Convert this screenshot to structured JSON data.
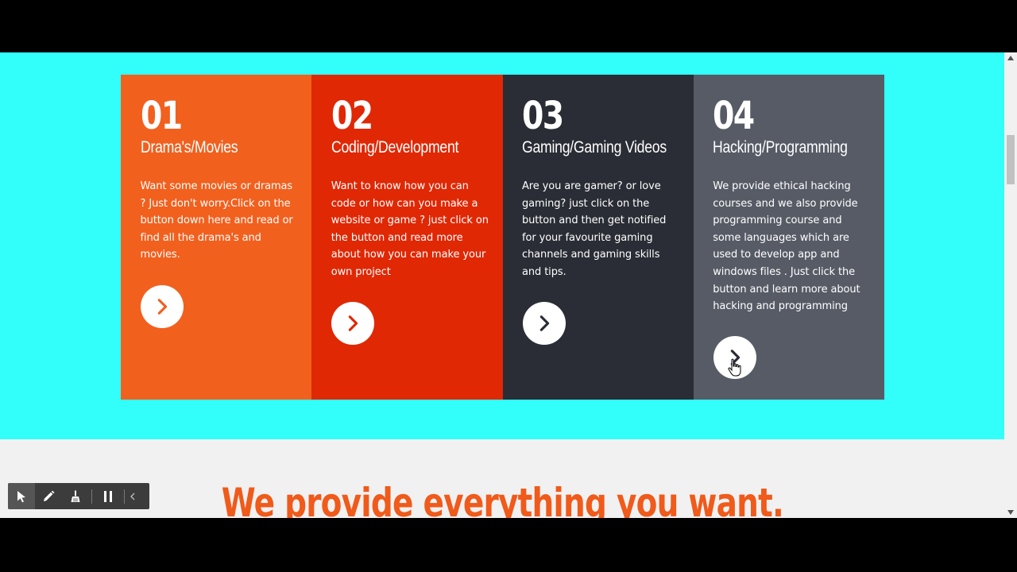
{
  "colors": {
    "cyan_band": "#32fff9",
    "card1": "#f2601e",
    "card2": "#e02805",
    "card3": "#2a2d35",
    "card4": "#575b66",
    "headline": "#f05a1a"
  },
  "cards": [
    {
      "number": "01",
      "title": "Drama's/Movies",
      "text": "Want some movies or dramas ? Just don't worry.Click on the button down here and read or find all the drama's and movies.",
      "arrow_icon": "chevron-right-icon",
      "arrow_color": "#f2601e"
    },
    {
      "number": "02",
      "title": "Coding/Development",
      "text": "Want to know how you can code or how can you make a website or game ? just click on the button and read more about how you can make your own project",
      "arrow_icon": "chevron-right-icon",
      "arrow_color": "#e02805"
    },
    {
      "number": "03",
      "title": "Gaming/Gaming Videos",
      "text": "Are you are gamer? or love gaming? just click on the button and then get notified for your favourite gaming channels and gaming skills and tips.",
      "arrow_icon": "chevron-right-icon",
      "arrow_color": "#2a2d35"
    },
    {
      "number": "04",
      "title": "Hacking/Programming",
      "text": "We provide ethical hacking courses and we also provide programming course and some languages which are used to develop app and windows files . Just click the button and learn more about hacking and programming",
      "arrow_icon": "chevron-right-icon",
      "arrow_color": "#2a2d35"
    }
  ],
  "headline": "We provide everything you want.",
  "toolbar": {
    "tools": [
      "pointer-icon",
      "pencil-icon",
      "broom-icon",
      "pause-icon",
      "collapse-chevron-icon"
    ]
  }
}
